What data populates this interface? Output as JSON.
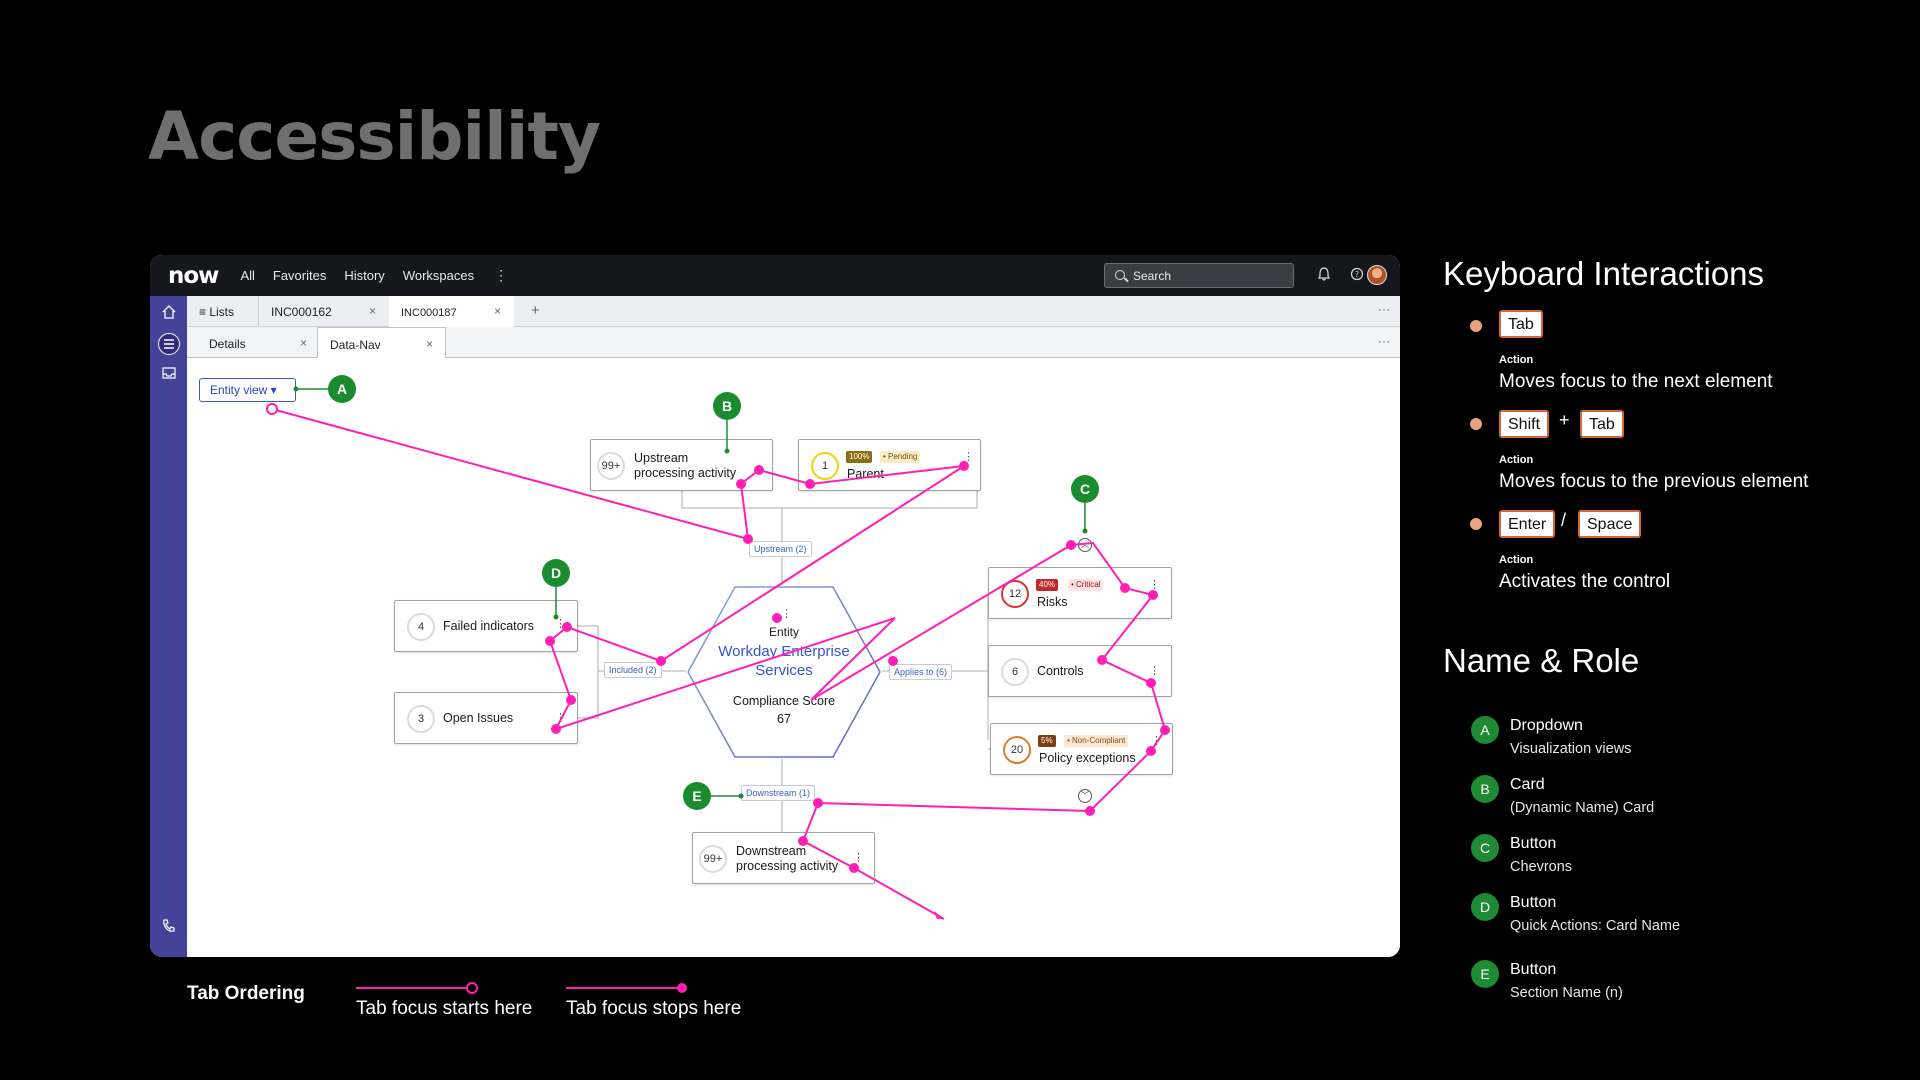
{
  "slide_title": "Accessibility",
  "app": {
    "logo": "now",
    "nav": [
      "All",
      "Favorites",
      "History",
      "Workspaces"
    ],
    "nav_more": "⋮",
    "search_placeholder": "Search",
    "tabs": [
      {
        "label": "Lists"
      },
      {
        "label": "INC000162"
      },
      {
        "label": "INC000187"
      }
    ],
    "add_tab": "+",
    "overflow": "···",
    "subtabs": [
      {
        "label": "Details"
      },
      {
        "label": "Data-Nav"
      }
    ],
    "close": "×"
  },
  "diagram": {
    "dropdown": "Entity view ▾",
    "upstream_card": {
      "count": "99+",
      "label_1": "Upstream",
      "label_2": "processing activity"
    },
    "parent_card": {
      "count": "1",
      "percent": "100%",
      "status": "• Pending",
      "label": "Parent"
    },
    "upstream_edge": "Upstream (2)",
    "failed_card": {
      "count": "4",
      "label": "Failed indicators"
    },
    "open_card": {
      "count": "3",
      "label": "Open Issues"
    },
    "included_edge": "Included (2)",
    "entity": {
      "kind": "Entity",
      "name_1": "Workday Enterprise",
      "name_2": "Services",
      "score_label": "Compliance Score",
      "score": "67"
    },
    "applies_edge": "Applies to (6)",
    "risks_card": {
      "count": "12",
      "percent": "40%",
      "status": "• Critical",
      "label": "Risks"
    },
    "controls_card": {
      "count": "6",
      "label": "Controls"
    },
    "policy_card": {
      "count": "20",
      "percent": "5%",
      "status": "• Non-Compliant",
      "label": "Policy exceptions"
    },
    "downstream_edge": "Downstream (1)",
    "downstream_card": {
      "count": "99+",
      "label_1": "Downstream",
      "label_2": "processing activity"
    },
    "kebab": "⋮",
    "badges": {
      "a": "A",
      "b": "B",
      "c": "C",
      "d": "D",
      "e": "E"
    }
  },
  "legend": {
    "title": "Tab Ordering",
    "start": "Tab focus starts here",
    "stop": "Tab focus stops here",
    "color": "#ff1fb4"
  },
  "keyboard": {
    "heading": "Keyboard Interactions",
    "action_label": "Action",
    "items": [
      {
        "keys": [
          "Tab"
        ],
        "sep": "",
        "action": "Moves focus to the next element"
      },
      {
        "keys": [
          "Shift",
          "Tab"
        ],
        "sep": "+",
        "action": "Moves focus to the previous element"
      },
      {
        "keys": [
          "Enter",
          "Space"
        ],
        "sep": "/",
        "action": "Activates the control"
      }
    ]
  },
  "name_role": {
    "heading": "Name & Role",
    "items": [
      {
        "badge": "A",
        "role": "Dropdown",
        "name": "Visualization views"
      },
      {
        "badge": "B",
        "role": "Card",
        "name": "(Dynamic Name) Card"
      },
      {
        "badge": "C",
        "role": "Button",
        "name": "Chevrons"
      },
      {
        "badge": "D",
        "role": "Button",
        "name": "Quick Actions: Card Name"
      },
      {
        "badge": "E",
        "role": "Button",
        "name": "Section Name (n)"
      }
    ]
  },
  "colors": {
    "badge_green": "#1a8c2f",
    "focus_pink": "#ff1fb4",
    "sidebar": "#454299",
    "key_border": "#d9663a"
  }
}
